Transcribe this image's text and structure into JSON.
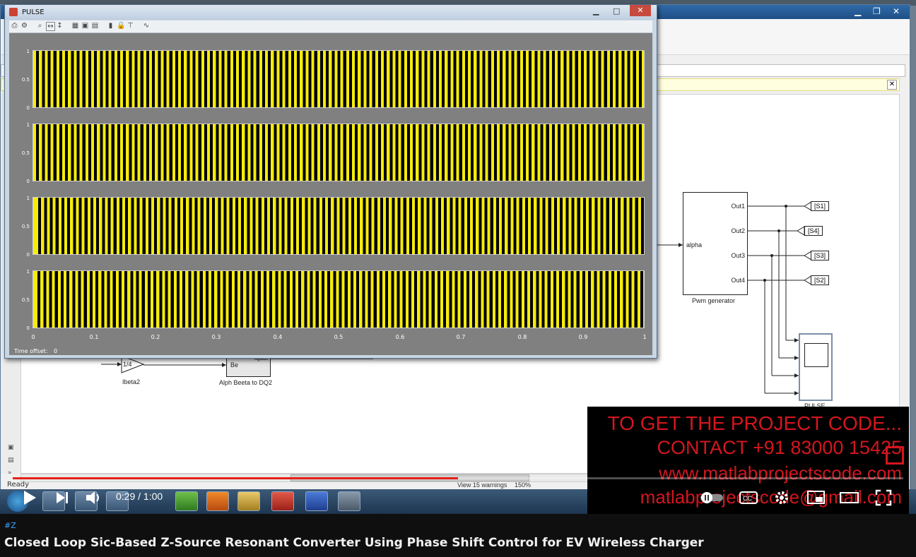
{
  "scope": {
    "title": "PULSE",
    "yticks": [
      "1",
      "0.5",
      "0"
    ],
    "xticks": [
      "0",
      "0.1",
      "0.2",
      "0.3",
      "0.4",
      "0.5",
      "0.6",
      "0.7",
      "0.8",
      "0.9",
      "1"
    ],
    "time_offset_label": "Time offset:",
    "time_offset_value": "0",
    "signal_colors": {
      "high": "#f5ec0a",
      "low": "#000000",
      "background": "#808080"
    }
  },
  "simulink": {
    "status": "Ready",
    "warnings": "View 15 warnings",
    "zoom": "150%",
    "pwm_block": {
      "label": "Pwm generator",
      "input": "alpha",
      "outputs": [
        "Out1",
        "Out2",
        "Out3",
        "Out4"
      ]
    },
    "goto_tags": [
      "[S1]",
      "[S4]",
      "[S3]",
      "[S2]"
    ],
    "gain_block": {
      "value": "1/4",
      "label": "Ibeta2"
    },
    "transform_block": {
      "port_in": "Be",
      "port_out": "Iqact",
      "label": "Alph Beeta to DQ2"
    },
    "scope_block_label": "PULSE"
  },
  "overlay": {
    "line1": "TO GET THE PROJECT CODE...",
    "line2": "CONTACT +91 83000 15425",
    "line3": "www.matlabprojectscode.com",
    "line4": "matlabprojectscode@gmail.com",
    "color": "#d3161e"
  },
  "player": {
    "current_time": "0:29",
    "separator": " / ",
    "duration": "1:00",
    "progress": 0.5
  },
  "video_info": {
    "hashtag": "#Z",
    "title": "Closed Loop Sic-Based Z-Source Resonant Converter Using Phase Shift Control for EV Wireless Charger"
  }
}
